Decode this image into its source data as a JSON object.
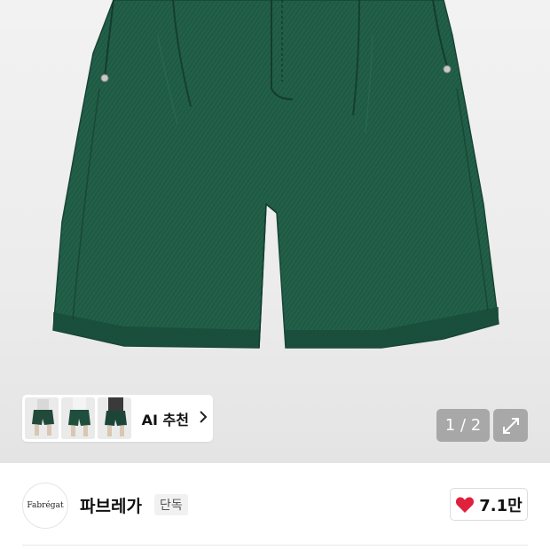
{
  "product_image": {
    "alt": "green pleated denim shorts",
    "pants_color": "#1f5a45"
  },
  "ai_recommend": {
    "label": "AI 추천",
    "chevron": "chevron-right-icon",
    "thumbnails": [
      {
        "pants_color": "#214a3a"
      },
      {
        "pants_color": "#1f4f3c"
      },
      {
        "pants_color": "#1c4537"
      }
    ]
  },
  "gallery": {
    "counter": "1 / 2",
    "expand_icon": "expand-icon"
  },
  "brand": {
    "logo_text": "Fabrégat",
    "name": "파브레가",
    "tag": "단독"
  },
  "like": {
    "count": "7.1만",
    "icon": "heart-icon",
    "color": "#e0213c"
  }
}
